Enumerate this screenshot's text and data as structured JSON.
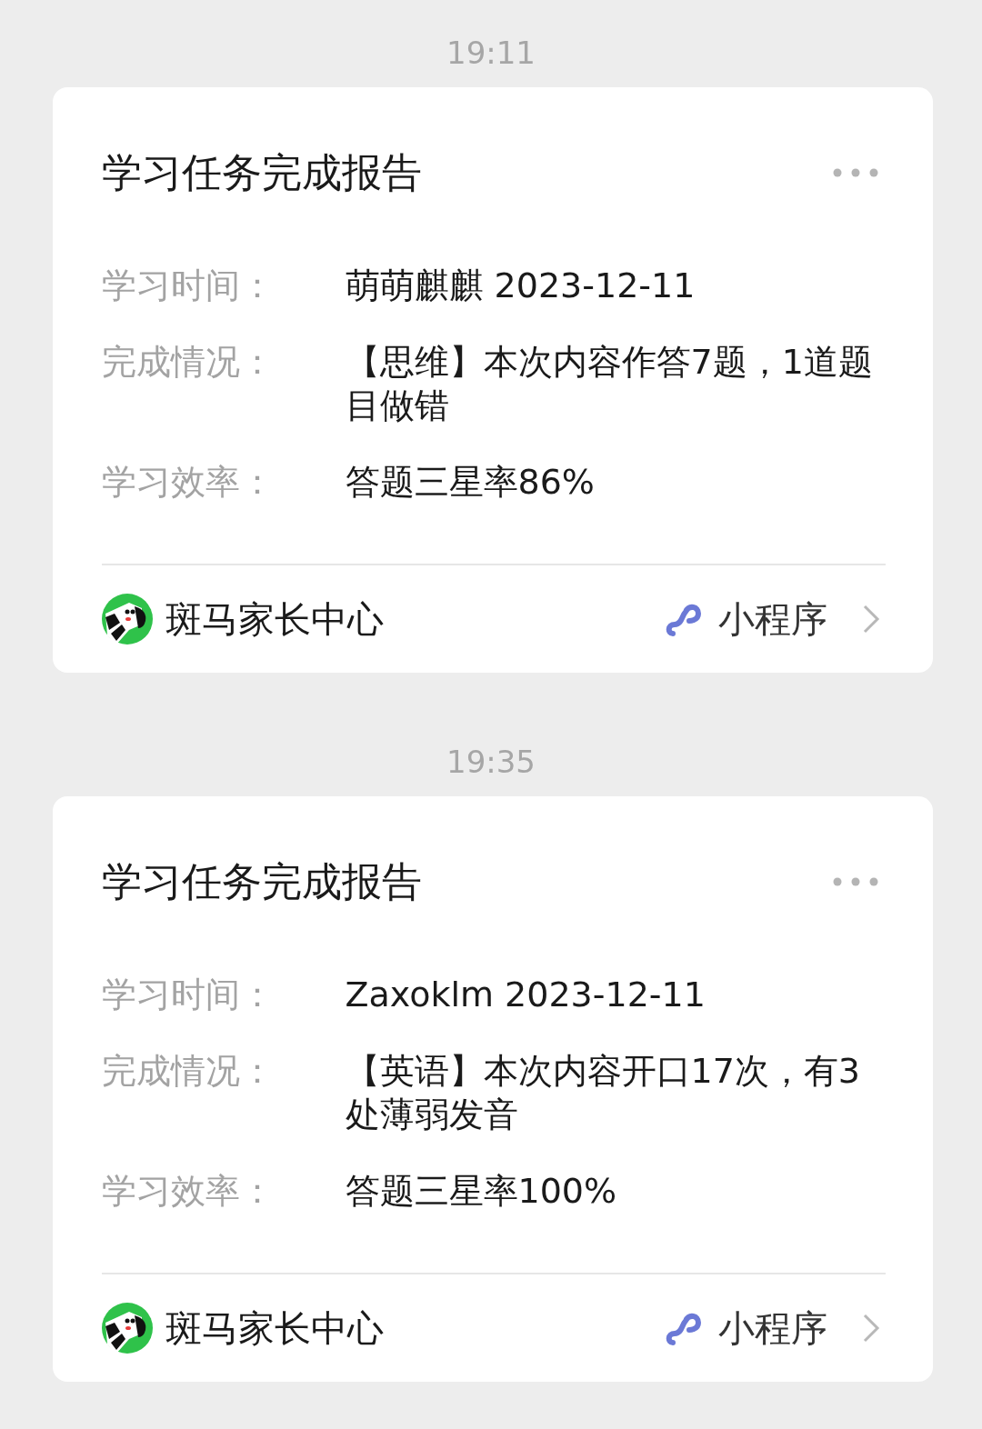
{
  "messages": [
    {
      "time": "19:11",
      "card": {
        "title": "学习任务完成报告",
        "fields": [
          {
            "label": "学习时间：",
            "value": "萌萌麒麒 2023-12-11"
          },
          {
            "label": "完成情况：",
            "value": "【思维】本次内容作答7题，1道题目做错"
          },
          {
            "label": "学习效率：",
            "value": "答题三星率86%"
          }
        ],
        "app_name": "斑马家长中心",
        "app_type": "小程序"
      }
    },
    {
      "time": "19:35",
      "card": {
        "title": "学习任务完成报告",
        "fields": [
          {
            "label": "学习时间：",
            "value": "Zaxoklm 2023-12-11"
          },
          {
            "label": "完成情况：",
            "value": "【英语】本次内容开口17次，有3处薄弱发音"
          },
          {
            "label": "学习效率：",
            "value": "答题三星率100%"
          }
        ],
        "app_name": "斑马家长中心",
        "app_type": "小程序"
      }
    }
  ]
}
